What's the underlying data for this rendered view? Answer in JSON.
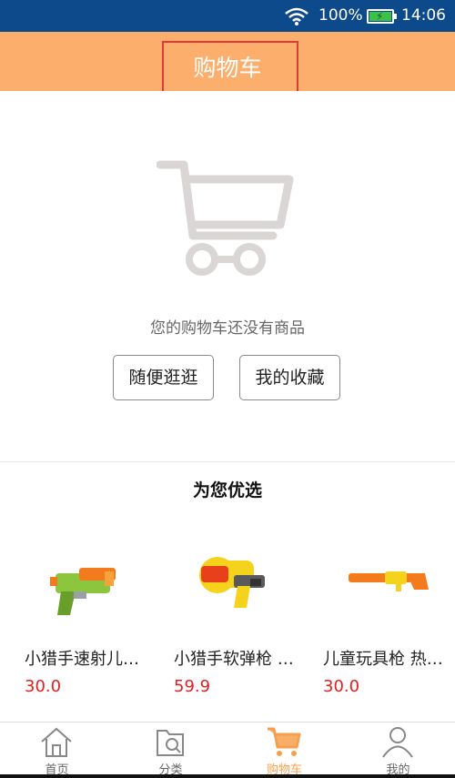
{
  "status_bar": {
    "battery_percent": "100%",
    "time": "14:06",
    "battery_level": 1.0
  },
  "header": {
    "title": "购物车"
  },
  "empty_cart": {
    "message": "您的购物车还没有商品",
    "browse_button": "随便逛逛",
    "favorites_button": "我的收藏"
  },
  "recommend": {
    "title": "为您优选",
    "products": [
      {
        "name": "小猎手速射儿童玩具枪",
        "price": "30.0"
      },
      {
        "name": "小猎手软弹枪 玩具枪",
        "price": "59.9"
      },
      {
        "name": "儿童玩具枪 热卖款",
        "price": "30.0"
      }
    ]
  },
  "tabbar": {
    "items": [
      {
        "label": "首页"
      },
      {
        "label": "分类"
      },
      {
        "label": "购物车"
      },
      {
        "label": "我的"
      }
    ],
    "active_color": "#f6a04f"
  },
  "colors": {
    "header_bg": "#fcae6c",
    "status_bg": "#0d4a8c",
    "price": "#e02020"
  }
}
